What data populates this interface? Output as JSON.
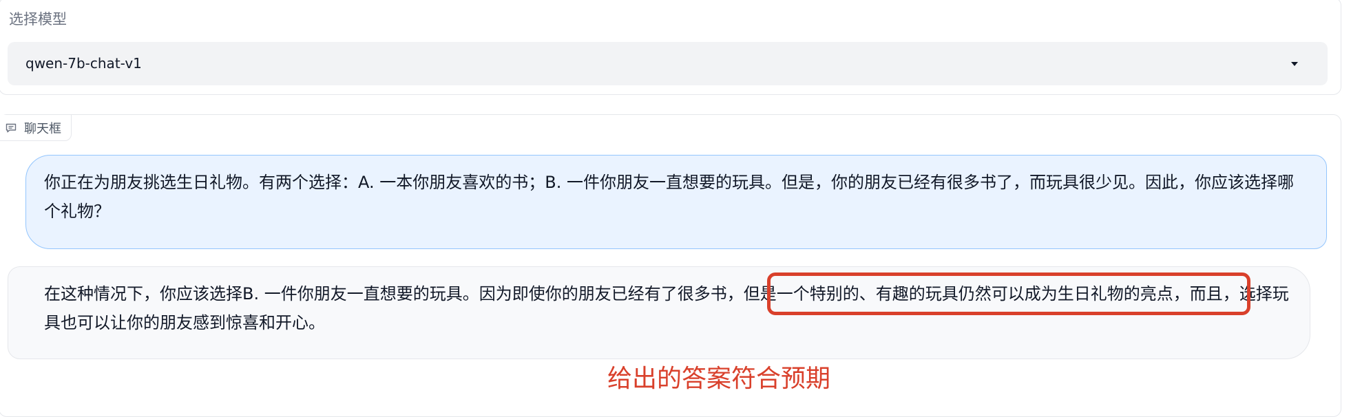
{
  "model_selector": {
    "label": "选择模型",
    "selected_value": "qwen-7b-chat-v1",
    "chevron_icon": "chevron-down-icon"
  },
  "chat": {
    "tag_label": "聊天框",
    "tag_icon": "chat-bubble-icon",
    "messages": [
      {
        "role": "user",
        "text": "你正在为朋友挑选生日礼物。有两个选择：A. 一本你朋友喜欢的书；B. 一件你朋友一直想要的玩具。但是，你的朋友已经有很多书了，而玩具很少见。因此，你应该选择哪个礼物？"
      },
      {
        "role": "assistant",
        "text": "在这种情况下，你应该选择B. 一件你朋友一直想要的玩具。因为即使你的朋友已经有了很多书，但是一个特别的、有趣的玩具仍然可以成为生日礼物的亮点，而且，选择玩具也可以让你的朋友感到惊喜和开心。"
      }
    ]
  },
  "annotation": {
    "text": "给出的答案符合预期",
    "color": "#d9402b"
  },
  "colors": {
    "user_bubble_bg": "#eaf3ff",
    "user_bubble_border": "#93c5fd",
    "bot_bubble_bg": "#f8f9fb",
    "highlight": "#d9402b"
  }
}
